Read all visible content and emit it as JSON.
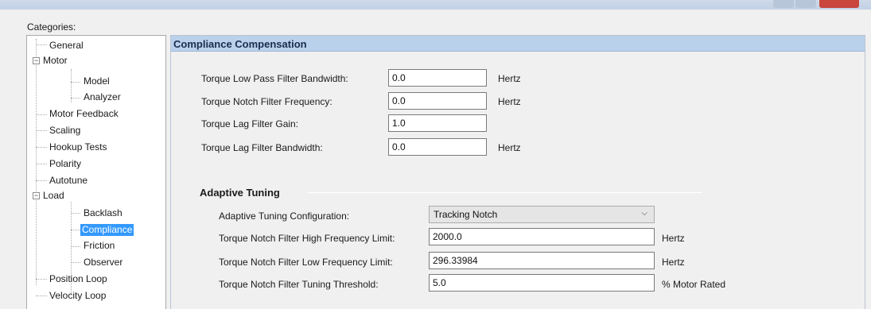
{
  "categories_label": "Categories:",
  "tree": {
    "general": "General",
    "motor": "Motor",
    "model": "Model",
    "analyzer": "Analyzer",
    "motor_feedback": "Motor Feedback",
    "scaling": "Scaling",
    "hookup_tests": "Hookup Tests",
    "polarity": "Polarity",
    "autotune": "Autotune",
    "load": "Load",
    "backlash": "Backlash",
    "compliance": "Compliance",
    "friction": "Friction",
    "observer": "Observer",
    "position_loop": "Position Loop",
    "velocity_loop": "Velocity Loop"
  },
  "panel": {
    "title": "Compliance Compensation",
    "fields": {
      "tlp_bw_label": "Torque Low Pass Filter Bandwidth:",
      "tlp_bw_value": "0.0",
      "tlp_bw_unit": "Hertz",
      "tn_freq_label": "Torque Notch Filter Frequency:",
      "tn_freq_value": "0.0",
      "tn_freq_unit": "Hertz",
      "tlag_gain_label": "Torque Lag Filter Gain:",
      "tlag_gain_value": "1.0",
      "tlag_bw_label": "Torque Lag Filter Bandwidth:",
      "tlag_bw_value": "0.0",
      "tlag_bw_unit": "Hertz"
    },
    "adaptive": {
      "title": "Adaptive Tuning",
      "config_label": "Adaptive Tuning Configuration:",
      "config_value": "Tracking Notch",
      "high_label": "Torque Notch Filter High Frequency Limit:",
      "high_value": "2000.0",
      "high_unit": "Hertz",
      "low_label": "Torque Notch Filter Low Frequency Limit:",
      "low_value": "296.33984",
      "low_unit": "Hertz",
      "threshold_label": "Torque Notch Filter Tuning Threshold:",
      "threshold_value": "5.0",
      "threshold_unit": "% Motor Rated"
    }
  },
  "icons": {
    "expanded_glyph": "−",
    "dropdown_glyph": "⌵"
  }
}
